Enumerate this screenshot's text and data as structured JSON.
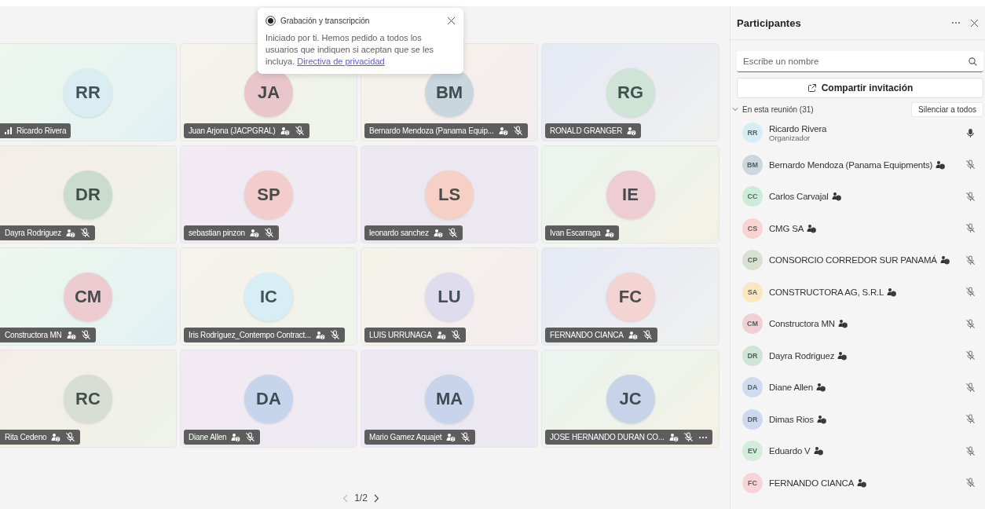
{
  "notice": {
    "title": "Grabación y transcripción",
    "text": "Iniciado por ti. Hemos pedido a todos los usuarios que indiquen si aceptan que se les incluya. ",
    "link": "Directiva de privacidad"
  },
  "tiles": [
    {
      "initials": "RR",
      "name": "Ricardo Rivera",
      "color": "#d9edf3",
      "speaking": true,
      "guest": false,
      "muted": false,
      "more": false
    },
    {
      "initials": "JA",
      "name": "Juan Arjona (JACPGRAL)",
      "color": "#e9c6cc",
      "speaking": false,
      "guest": true,
      "muted": true,
      "more": false
    },
    {
      "initials": "BM",
      "name": "Bernardo Mendoza (Panama Equip...",
      "color": "#c9d6dd",
      "speaking": false,
      "guest": true,
      "muted": true,
      "more": false
    },
    {
      "initials": "RG",
      "name": "RONALD GRANGER",
      "color": "#cfe4d6",
      "speaking": false,
      "guest": true,
      "muted": false,
      "more": false
    },
    {
      "initials": "DR",
      "name": "Dayra Rodriguez",
      "color": "#c9dccf",
      "speaking": false,
      "guest": true,
      "muted": true,
      "more": false
    },
    {
      "initials": "SP",
      "name": "sebastian pinzon",
      "color": "#f3cdcd",
      "speaking": false,
      "guest": true,
      "muted": true,
      "more": false
    },
    {
      "initials": "LS",
      "name": "leonardo sanchez",
      "color": "#f6d0c5",
      "speaking": false,
      "guest": true,
      "muted": true,
      "more": false
    },
    {
      "initials": "IE",
      "name": "Ivan Escarraga",
      "color": "#edcdd3",
      "speaking": false,
      "guest": true,
      "muted": false,
      "more": false
    },
    {
      "initials": "CM",
      "name": "Constructora MN",
      "color": "#ecccd1",
      "speaking": false,
      "guest": true,
      "muted": true,
      "more": false
    },
    {
      "initials": "IC",
      "name": "Iris Rodríguez_Contempo Contract...",
      "color": "#d6eef4",
      "speaking": false,
      "guest": true,
      "muted": true,
      "more": false
    },
    {
      "initials": "LU",
      "name": "LUIS URRUNAGA",
      "color": "#dfdcee",
      "speaking": false,
      "guest": true,
      "muted": true,
      "more": false
    },
    {
      "initials": "FC",
      "name": "FERNANDO CIANCA",
      "color": "#f4d3d3",
      "speaking": false,
      "guest": true,
      "muted": true,
      "more": false
    },
    {
      "initials": "RC",
      "name": "Rita Cedeno",
      "color": "#d8ded4",
      "speaking": false,
      "guest": true,
      "muted": true,
      "more": false
    },
    {
      "initials": "DA",
      "name": "Diane Allen",
      "color": "#c6d5eb",
      "speaking": false,
      "guest": true,
      "muted": true,
      "more": false
    },
    {
      "initials": "MA",
      "name": "Mario Gamez Aquajet",
      "color": "#c8d4eb",
      "speaking": false,
      "guest": true,
      "muted": true,
      "more": false
    },
    {
      "initials": "JC",
      "name": "JOSE HERNANDO DURAN CO...",
      "color": "#c7d3e9",
      "speaking": false,
      "guest": true,
      "muted": true,
      "more": true
    }
  ],
  "pager": {
    "text": "1/2"
  },
  "panel": {
    "title": "Participantes",
    "search": {
      "placeholder": "Escribe un nombre"
    },
    "invite_button": "Compartir invitación",
    "section": {
      "label": "En esta reunión (31)",
      "expanded": true,
      "mute_all_button": "Silenciar a todos"
    },
    "participants": [
      {
        "initials": "RR",
        "name": "Ricardo Rivera",
        "subtitle": "Organizador",
        "color": "#d6eef3",
        "guest": false,
        "muted": false
      },
      {
        "initials": "BM",
        "name": "Bernardo Mendoza (Panama Equipments)",
        "color": "#cbd6de",
        "guest": true,
        "muted": true
      },
      {
        "initials": "CC",
        "name": "Carlos Carvajal",
        "color": "#cdebd9",
        "guest": true,
        "muted": true
      },
      {
        "initials": "CS",
        "name": "CMG SA",
        "color": "#f9d3d1",
        "guest": true,
        "muted": true
      },
      {
        "initials": "CP",
        "name": "CONSORCIO CORREDOR SUR PANAMÁ",
        "color": "#d8e0d2",
        "guest": true,
        "muted": true
      },
      {
        "initials": "SA",
        "name": "CONSTRUCTORA AG, S.R.L",
        "color": "#fbe7bf",
        "guest": true,
        "muted": true
      },
      {
        "initials": "CM",
        "name": "Constructora MN",
        "color": "#f0cfd5",
        "guest": true,
        "muted": true
      },
      {
        "initials": "DR",
        "name": "Dayra Rodriguez",
        "color": "#cfe5d6",
        "guest": true,
        "muted": true
      },
      {
        "initials": "DA",
        "name": "Diane Allen",
        "color": "#cfdcf0",
        "guest": true,
        "muted": true
      },
      {
        "initials": "DR",
        "name": "Dimas Rios",
        "color": "#cdd8ef",
        "guest": true,
        "muted": true
      },
      {
        "initials": "EV",
        "name": "Eduardo V",
        "color": "#d3ecdc",
        "guest": true,
        "muted": true
      },
      {
        "initials": "FC",
        "name": "FERNANDO CIANCA",
        "color": "#f8d4d8",
        "guest": true,
        "muted": true
      }
    ]
  }
}
